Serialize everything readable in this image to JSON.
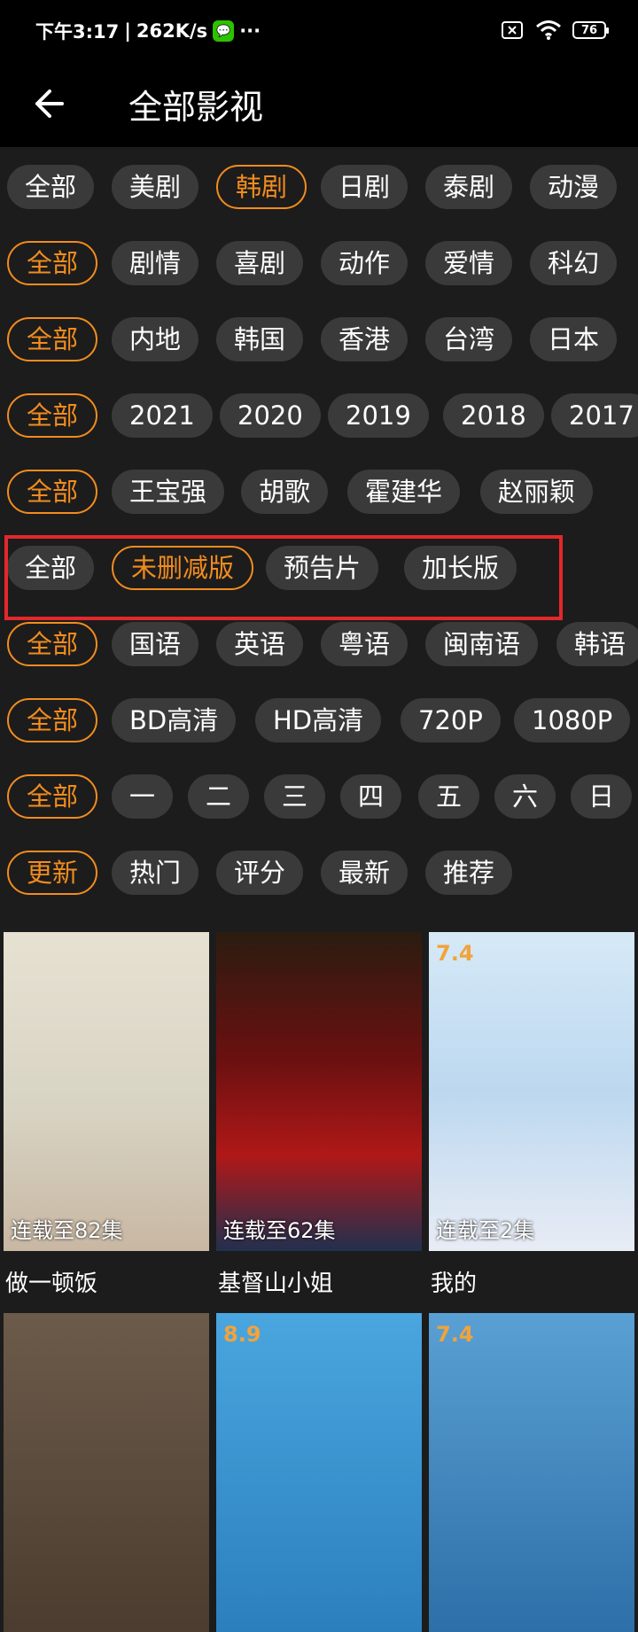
{
  "status": {
    "time": "下午3:17",
    "net_speed": "262K/s",
    "more": "···",
    "battery": "76"
  },
  "header": {
    "title": "全部影视"
  },
  "colors": {
    "accent": "#f28c1e",
    "chip_bg": "#3a3a3a",
    "highlight": "#e3282b"
  },
  "filters": [
    {
      "chips": [
        "全部",
        "美剧",
        "韩剧",
        "日剧",
        "泰剧",
        "动漫"
      ],
      "active": 2
    },
    {
      "chips": [
        "全部",
        "剧情",
        "喜剧",
        "动作",
        "爱情",
        "科幻"
      ],
      "active": 0
    },
    {
      "chips": [
        "全部",
        "内地",
        "韩国",
        "香港",
        "台湾",
        "日本"
      ],
      "active": 0
    },
    {
      "chips": [
        "全部",
        "2021",
        "2020",
        "2019",
        "2018",
        "2017"
      ],
      "active": 0
    },
    {
      "chips": [
        "全部",
        "王宝强",
        "胡歌",
        "霍建华",
        "赵丽颖"
      ],
      "active": 0
    },
    {
      "chips": [
        "全部",
        "未删减版",
        "预告片",
        "加长版"
      ],
      "active": 1
    },
    {
      "chips": [
        "全部",
        "国语",
        "英语",
        "粤语",
        "闽南语",
        "韩语"
      ],
      "active": 0
    },
    {
      "chips": [
        "全部",
        "BD高清",
        "HD高清",
        "720P",
        "1080P"
      ],
      "active": 0
    },
    {
      "chips": [
        "全部",
        "一",
        "二",
        "三",
        "四",
        "五",
        "六",
        "日"
      ],
      "active": 0
    },
    {
      "chips": [
        "更新",
        "热门",
        "评分",
        "最新",
        "推荐"
      ],
      "active": 0
    }
  ],
  "cards": [
    {
      "title": "做一顿饭",
      "episodes": "连载至82集",
      "rating": ""
    },
    {
      "title": "基督山小姐",
      "episodes": "连载至62集",
      "rating": ""
    },
    {
      "title": "我的",
      "episodes": "连载至2集",
      "rating": "7.4"
    },
    {
      "title": "",
      "episodes": "",
      "rating": ""
    },
    {
      "title": "",
      "episodes": "",
      "rating": "8.9"
    },
    {
      "title": "",
      "episodes": "",
      "rating": "7.4"
    }
  ]
}
